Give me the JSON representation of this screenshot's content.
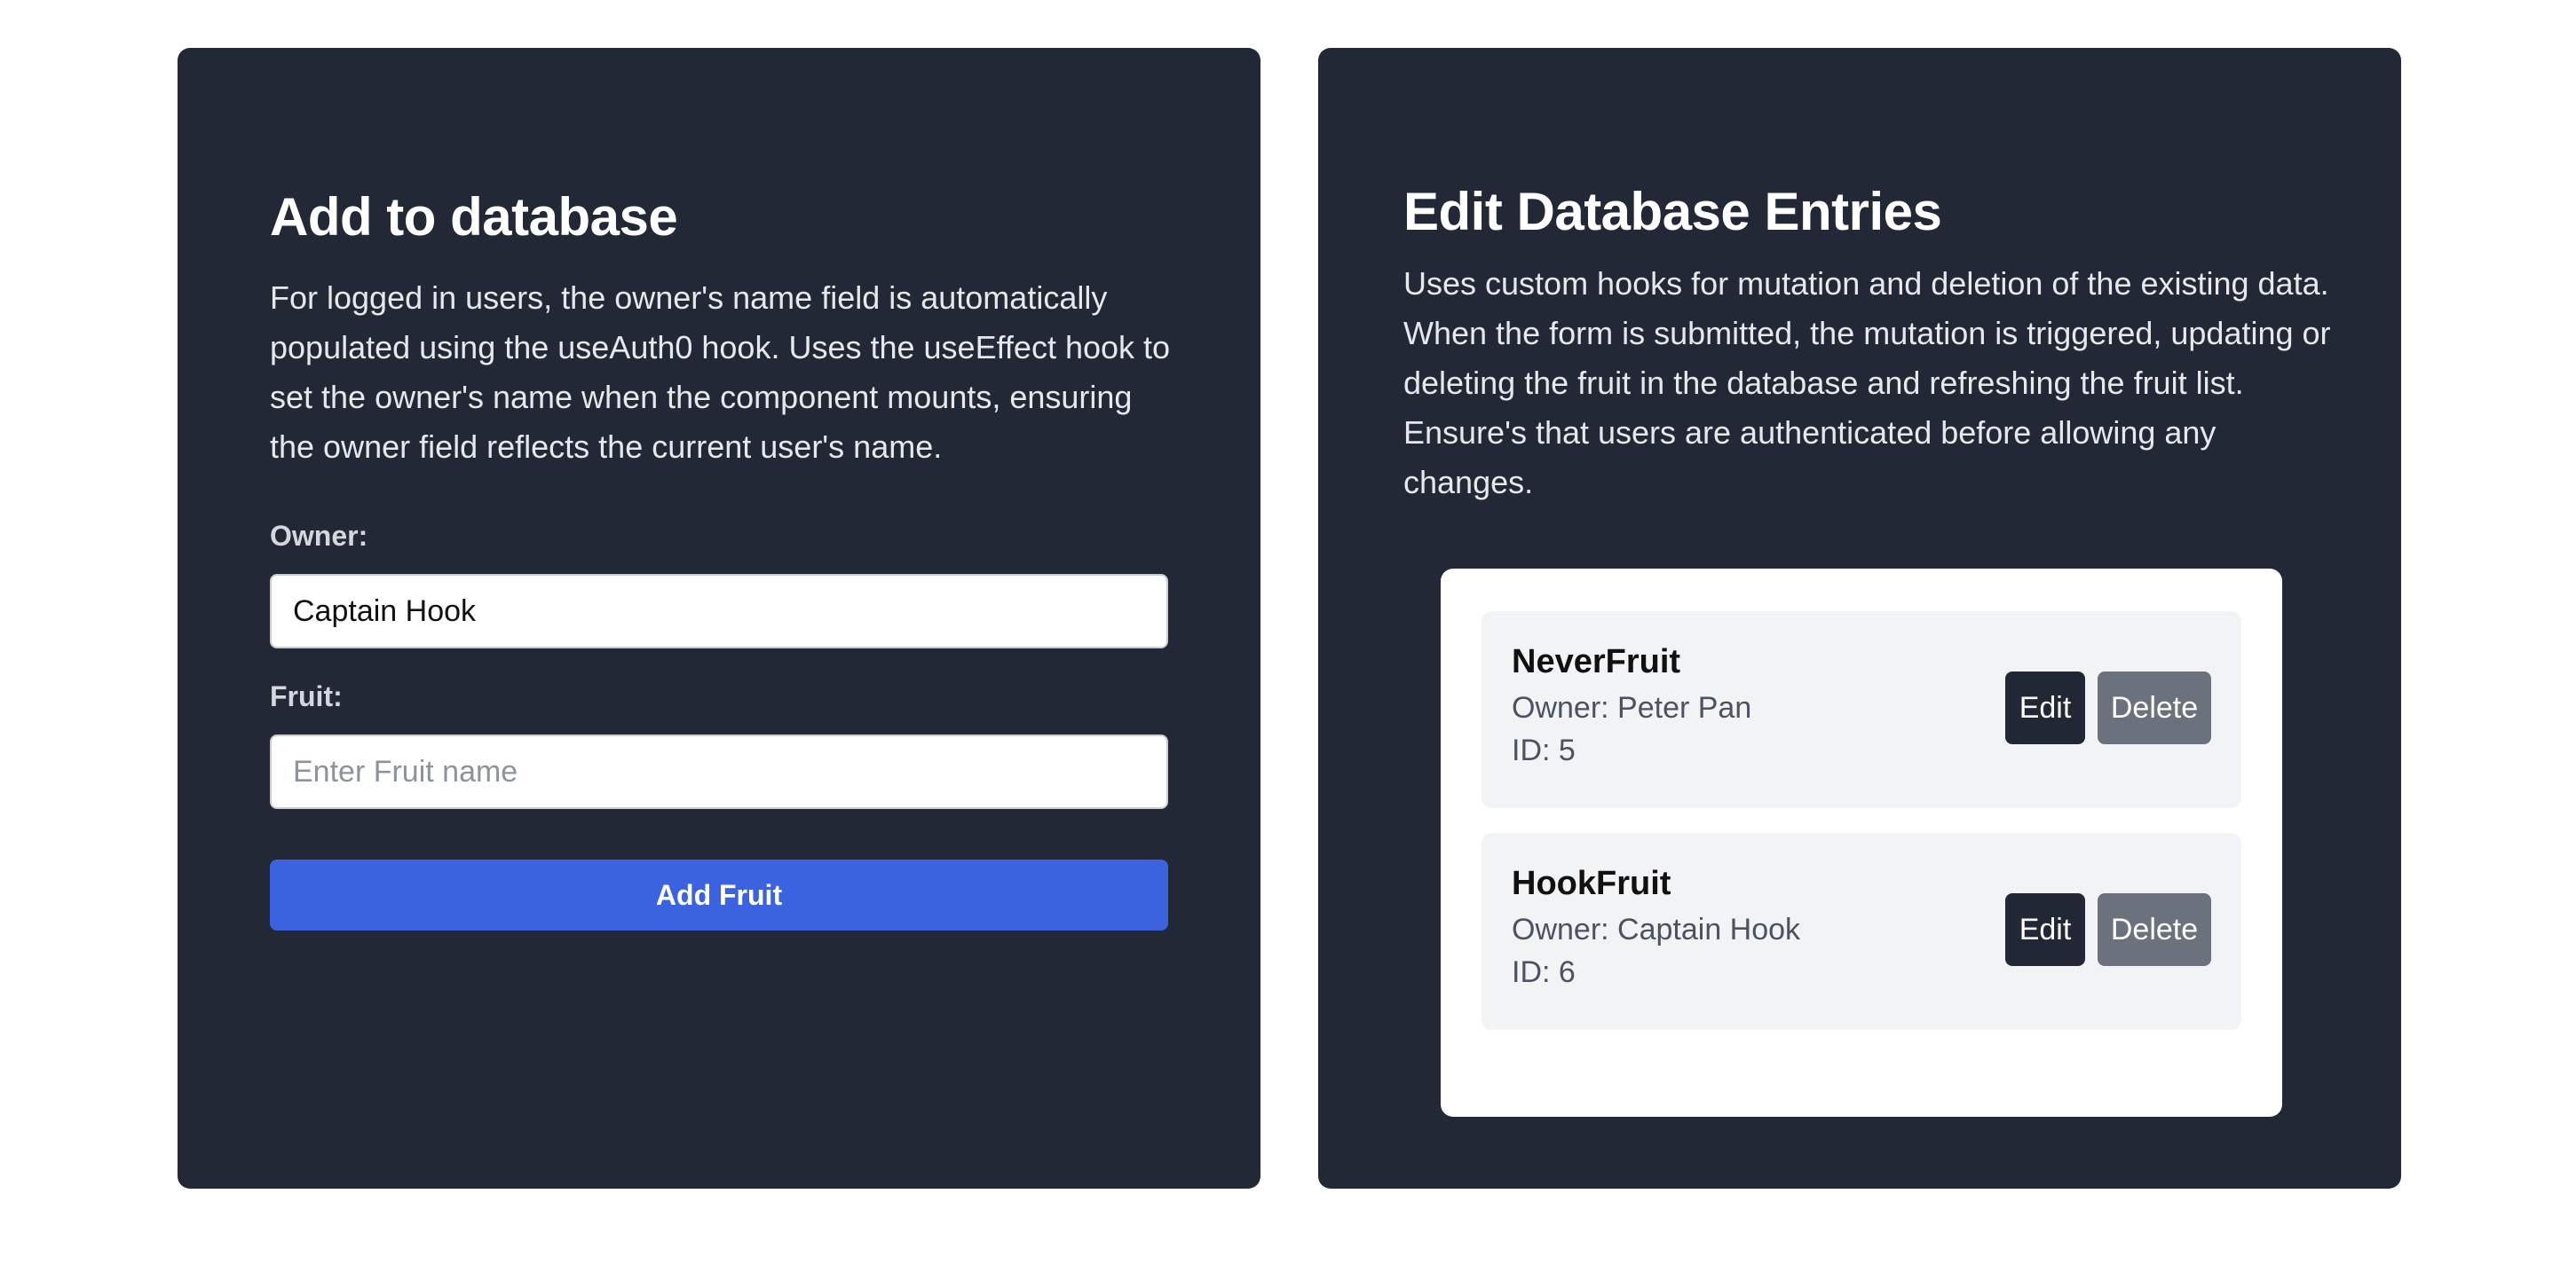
{
  "add_panel": {
    "title": "Add to database",
    "description": "For logged in users, the owner's name field is automatically populated using the useAuth0 hook. Uses the useEffect hook to set the owner's name when the component mounts, ensuring the owner field reflects the current user's name.",
    "owner_label": "Owner:",
    "owner_value": "Captain Hook",
    "fruit_label": "Fruit:",
    "fruit_placeholder": "Enter Fruit name",
    "fruit_value": "",
    "submit_label": "Add Fruit"
  },
  "edit_panel": {
    "title": "Edit Database Entries",
    "description": "Uses custom hooks for mutation and deletion of the existing data. When the form is submitted, the mutation is triggered, updating or deleting the fruit in the database and refreshing the fruit list. Ensure's that users are authenticated before allowing any changes.",
    "entries": [
      {
        "name": "NeverFruit",
        "owner_text": "Owner: Peter Pan",
        "id_text": "ID: 5",
        "edit_label": "Edit",
        "delete_label": "Delete"
      },
      {
        "name": "HookFruit",
        "owner_text": "Owner: Captain Hook",
        "id_text": "ID: 6",
        "edit_label": "Edit",
        "delete_label": "Delete"
      }
    ]
  },
  "colors": {
    "panel_bg": "#222836",
    "primary_button": "#3b63e0",
    "edit_button": "#212734",
    "delete_button": "#6c727d",
    "entry_bg": "#f2f3f5"
  }
}
